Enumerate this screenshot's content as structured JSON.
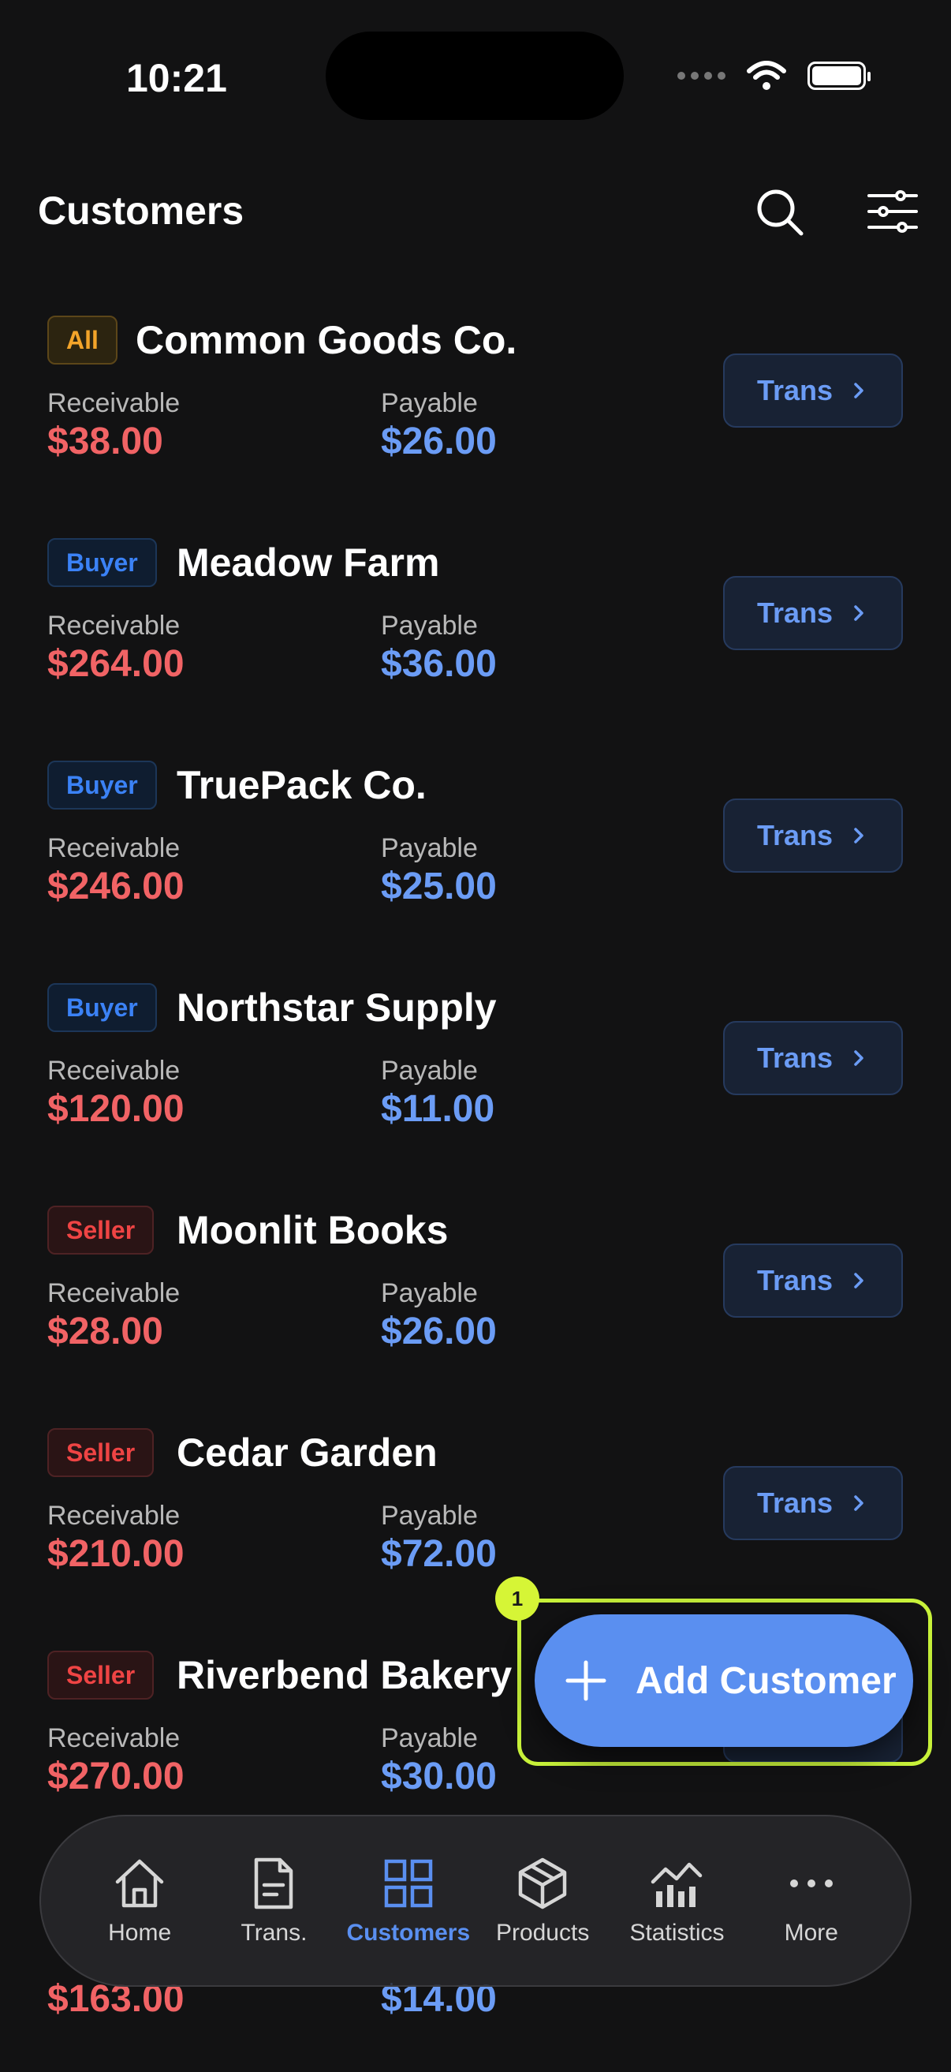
{
  "status_bar": {
    "time": "10:21"
  },
  "header": {
    "title": "Customers",
    "search_icon": "search-icon",
    "filter_icon": "sliders-icon"
  },
  "labels": {
    "receivable": "Receivable",
    "payable": "Payable",
    "trans": "Trans"
  },
  "customers": [
    {
      "badge": "All",
      "type": "all",
      "name": "Common Goods Co.",
      "receivable": "$38.00",
      "payable": "$26.00"
    },
    {
      "badge": "Buyer",
      "type": "buyer",
      "name": "Meadow Farm",
      "receivable": "$264.00",
      "payable": "$36.00"
    },
    {
      "badge": "Buyer",
      "type": "buyer",
      "name": "TruePack Co.",
      "receivable": "$246.00",
      "payable": "$25.00"
    },
    {
      "badge": "Buyer",
      "type": "buyer",
      "name": "Northstar Supply",
      "receivable": "$120.00",
      "payable": "$11.00"
    },
    {
      "badge": "Seller",
      "type": "seller",
      "name": "Moonlit Books",
      "receivable": "$28.00",
      "payable": "$26.00"
    },
    {
      "badge": "Seller",
      "type": "seller",
      "name": "Cedar Garden",
      "receivable": "$210.00",
      "payable": "$72.00"
    },
    {
      "badge": "Seller",
      "type": "seller",
      "name": "Riverbend Bakery",
      "receivable": "$270.00",
      "payable": "$30.00"
    },
    {
      "badge": "",
      "type": "",
      "name": "",
      "receivable": "$163.00",
      "payable": "$14.00"
    }
  ],
  "fab": {
    "label": "Add Customer",
    "icon": "plus-icon",
    "marker": "1"
  },
  "nav": {
    "items": [
      {
        "label": "Home",
        "icon": "home-icon"
      },
      {
        "label": "Trans.",
        "icon": "document-icon"
      },
      {
        "label": "Customers",
        "icon": "grid-icon",
        "active": true
      },
      {
        "label": "Products",
        "icon": "box-icon"
      },
      {
        "label": "Statistics",
        "icon": "chart-icon"
      },
      {
        "label": "More",
        "icon": "more-icon"
      }
    ]
  },
  "colors": {
    "accent": "#5a8ff0",
    "receivable": "#f16365",
    "payable": "#6b9cf5",
    "highlight": "#c8f23a"
  }
}
